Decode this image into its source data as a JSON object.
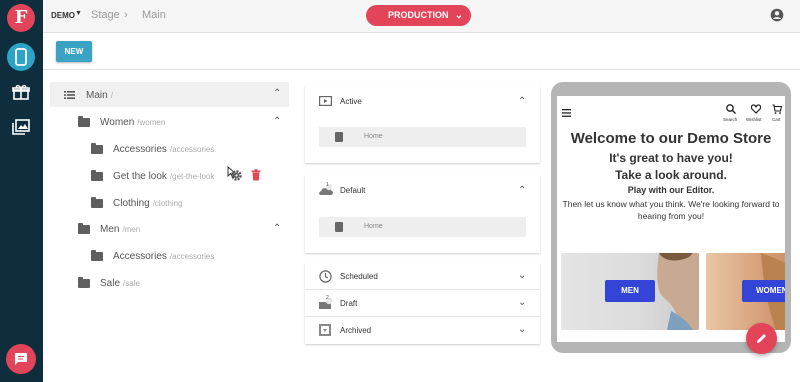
{
  "topbar": {
    "app": "DEMO",
    "crumbs": [
      "Stage",
      "Main"
    ],
    "env": "PRODUCTION"
  },
  "toolbar": {
    "new_label": "NEW"
  },
  "tree": {
    "root": {
      "label": "Main",
      "path": "/"
    },
    "women": {
      "label": "Women",
      "path": "/women"
    },
    "accessories1": {
      "label": "Accessories",
      "path": "/accessories"
    },
    "getthelook": {
      "label": "Get the look",
      "path": "/get-the-look"
    },
    "clothing": {
      "label": "Clothing",
      "path": "/clothing"
    },
    "men": {
      "label": "Men",
      "path": "/men"
    },
    "accessories2": {
      "label": "Accessories",
      "path": "/accessories"
    },
    "sale": {
      "label": "Sale",
      "path": "/sale"
    }
  },
  "panels": {
    "active": {
      "label": "Active",
      "page": "Home"
    },
    "default": {
      "label": "Default",
      "badge": "1",
      "page": "Home"
    },
    "scheduled": {
      "label": "Scheduled"
    },
    "draft": {
      "label": "Draft",
      "badge": "2"
    },
    "archived": {
      "label": "Archived"
    }
  },
  "preview": {
    "nav": {
      "search": "Search",
      "wishlist": "Wishlist",
      "cart": "Cart"
    },
    "title": "Welcome to our Demo Store",
    "sub1": "It's great to have you!",
    "sub2": "Take a look around.",
    "sub3": "Play with our Editor.",
    "body": "Then let us know what you think. We're looking forward to hearing from you!",
    "tiles": [
      {
        "label": "MEN"
      },
      {
        "label": "WOMEN"
      }
    ]
  },
  "colors": {
    "accent": "#e2455a",
    "nav": "#0e2e3e",
    "primary": "#3aa3c4",
    "tile_button": "#3344d6"
  }
}
